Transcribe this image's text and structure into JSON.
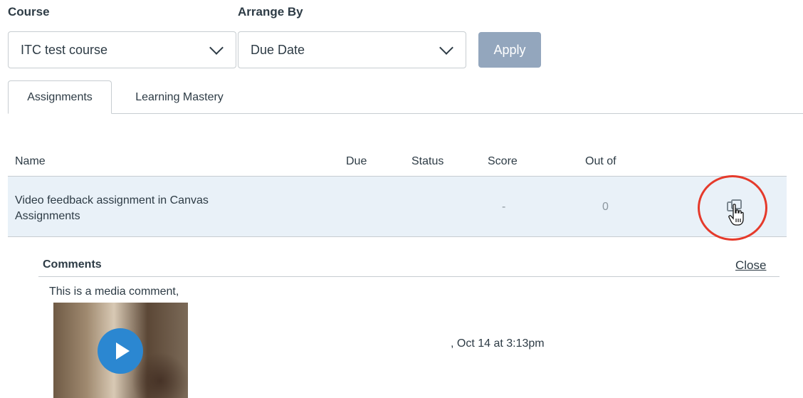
{
  "filters": {
    "course_label": "Course",
    "course_value": "ITC test course",
    "arrange_label": "Arrange By",
    "arrange_value": "Due Date",
    "apply_label": "Apply"
  },
  "tabs": [
    {
      "label": "Assignments",
      "active": true
    },
    {
      "label": "Learning Mastery",
      "active": false
    }
  ],
  "table": {
    "headers": [
      "Name",
      "Due",
      "Status",
      "Score",
      "Out of"
    ],
    "rows": [
      {
        "name_line1": "Video feedback assignment in Canvas",
        "name_line2": "Assignments",
        "due": "",
        "status": "",
        "score": "-",
        "out_of": "0"
      }
    ]
  },
  "comments": {
    "title": "Comments",
    "close_label": "Close",
    "text": "This is a media comment,",
    "timestamp": ", Oct 14 at 3:13pm"
  },
  "icons": {
    "comment": "comment-icon",
    "cursor": "hand-pointer-icon",
    "play": "play-icon"
  },
  "colors": {
    "highlight_row": "#e9f1f8",
    "apply_button": "#93a6bd",
    "annotation_ring": "#e53a2b",
    "play_button": "#2b87d1"
  }
}
